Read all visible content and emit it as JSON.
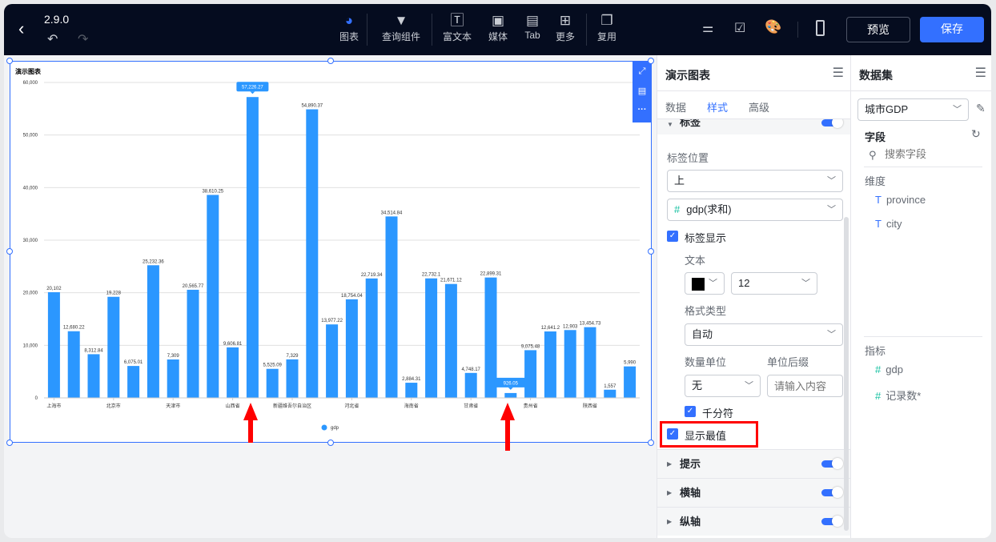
{
  "header": {
    "version": "2.9.0",
    "tools": [
      {
        "icon": "pie-chart-icon",
        "label": "图表"
      },
      {
        "icon": "filter-icon",
        "label": "查询组件"
      },
      {
        "icon": "rich-text-icon",
        "label": "富文本"
      },
      {
        "icon": "media-icon",
        "label": "媒体"
      },
      {
        "icon": "tab-icon",
        "label": "Tab"
      },
      {
        "icon": "more-icon",
        "label": "更多"
      },
      {
        "icon": "reuse-icon",
        "label": "复用"
      }
    ],
    "preview": "预览",
    "save": "保存"
  },
  "colors": {
    "accent": "#3370ff",
    "bar": "#2b97ff",
    "highlight": "#ff0000",
    "topbar": "#050c1f"
  },
  "chart_data": {
    "type": "bar",
    "title": "演示图表",
    "categories": [
      "上海市",
      "",
      "",
      "北京市",
      "",
      "",
      "天津市",
      "",
      "",
      "山西省",
      "",
      "",
      "新疆维吾尔自治区",
      "",
      "",
      "河北省",
      "",
      "",
      "海南省",
      "",
      "",
      "甘肃省",
      "",
      "",
      "贵州省",
      "",
      "",
      "陕西省",
      "",
      ""
    ],
    "series": [
      {
        "name": "gdp",
        "values": [
          20102,
          12680.22,
          8312.84,
          19228,
          6075.01,
          25232.36,
          7309,
          20565.77,
          38610.25,
          9606.81,
          57226.27,
          5525.09,
          7329,
          54890.37,
          13977.22,
          18754.04,
          22719.34,
          34514.84,
          2884.31,
          22732.1,
          21671.12,
          4748.17,
          22899.31,
          926.05,
          9075.48,
          12641.2,
          12903,
          13454.73,
          1557,
          5990
        ]
      }
    ],
    "labels": [
      "20,102",
      "12,680.22",
      "8,312.84",
      "19,228",
      "6,075.01",
      "25,232.36",
      "7,309",
      "20,565.77",
      "38,610.25",
      "9,606.81",
      "57,226.27",
      "5,525.09",
      "7,329",
      "54,890.37",
      "13,977.22",
      "18,754.04",
      "22,719.34",
      "34,514.84",
      "2,884.31",
      "22,732.1",
      "21,671.12",
      "4,748.17",
      "22,899.31",
      "926.05",
      "9,075.48",
      "12,641.2",
      "12,903",
      "13,454.73",
      "1,557",
      "5,990"
    ],
    "yticks": [
      "0",
      "10,000",
      "20,000",
      "30,000",
      "40,000",
      "50,000",
      "60,000"
    ],
    "ylim": [
      0,
      60000
    ],
    "grid": true,
    "legend": "bottom",
    "max_label": "57,226.27",
    "min_label": "926.05"
  },
  "panel": {
    "title": "演示图表",
    "tabs": [
      "数据",
      "样式",
      "高级"
    ],
    "active_tab": "样式",
    "label_section": "标签",
    "label_position_label": "标签位置",
    "label_position": "上",
    "label_field": "gdp(求和)",
    "show_label": "标签显示",
    "text_label": "文本",
    "font_size": "12",
    "text_color": "#000000",
    "format_type_label": "格式类型",
    "format_type": "自动",
    "unit_label": "数量单位",
    "unit": "无",
    "suffix_label": "单位后缀",
    "suffix_placeholder": "请输入内容",
    "thousands": "千分符",
    "show_extreme": "显示最值",
    "sections": [
      "提示",
      "横轴",
      "纵轴"
    ]
  },
  "dataset": {
    "title": "数据集",
    "selected": "城市GDP",
    "fields_label": "字段",
    "search_placeholder": "搜索字段",
    "dimensions_label": "维度",
    "dimensions": [
      "province",
      "city"
    ],
    "metrics_label": "指标",
    "metrics": [
      "gdp",
      "记录数*"
    ]
  }
}
